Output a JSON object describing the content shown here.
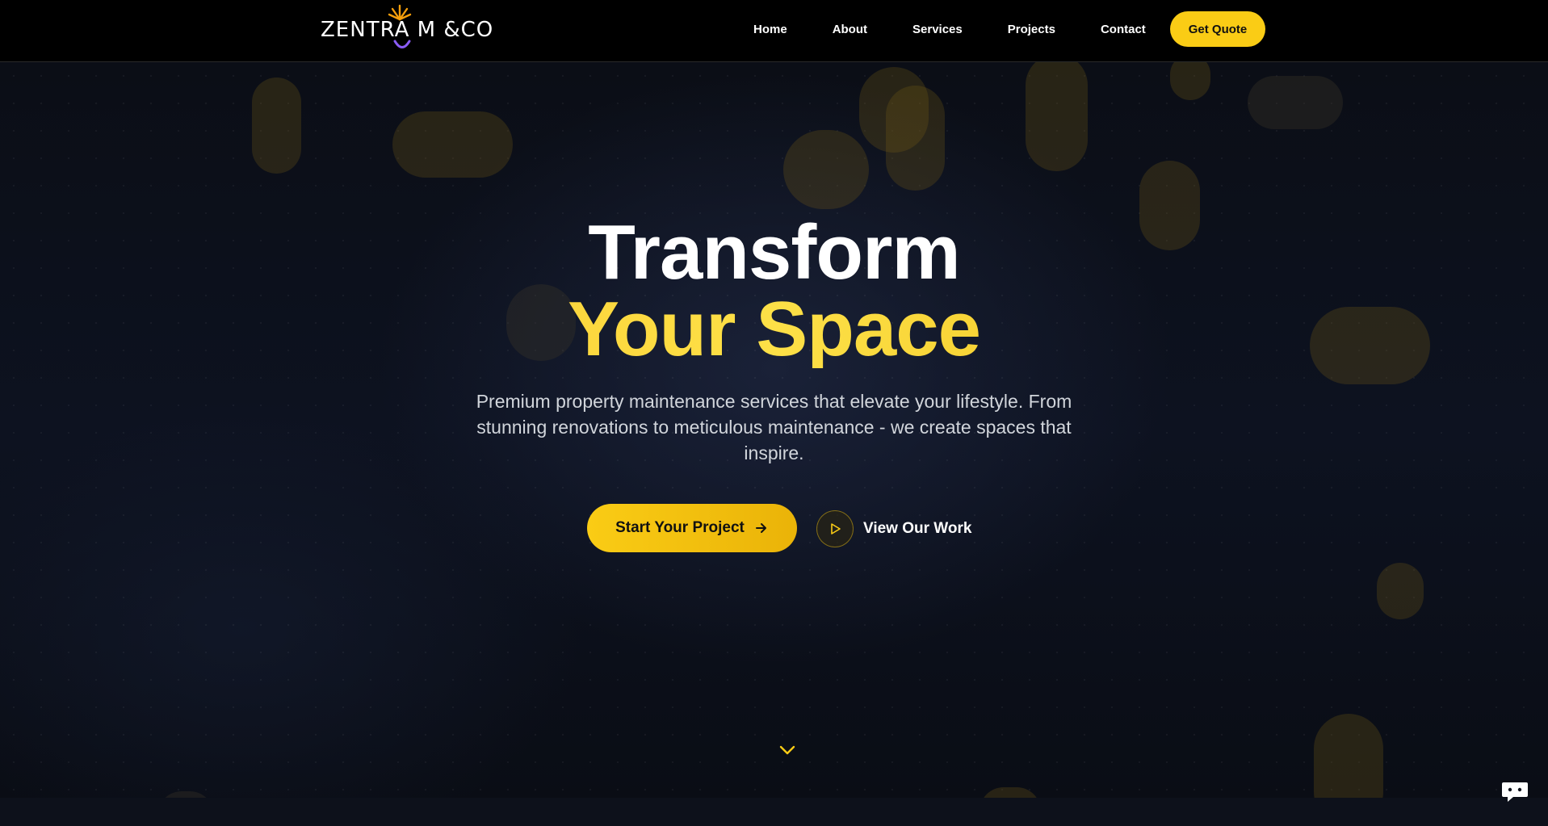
{
  "brand": {
    "logo_text": "ZENTRA M &CO",
    "accent": "#facc15"
  },
  "nav": {
    "items": [
      {
        "label": "Home"
      },
      {
        "label": "About"
      },
      {
        "label": "Services"
      },
      {
        "label": "Projects"
      },
      {
        "label": "Contact"
      }
    ],
    "cta_label": "Get Quote"
  },
  "hero": {
    "headline_line1": "Transform",
    "headline_line2": "Your Space",
    "subtitle": "Premium property maintenance services that elevate your lifestyle. From stunning renovations to meticulous maintenance - we create spaces that inspire.",
    "primary_cta": "Start Your Project",
    "secondary_cta": "View Our Work"
  },
  "icons": {
    "logo_sun": "sun-icon",
    "cta_arrow": "arrow-right-icon",
    "play": "play-icon",
    "scroll": "chevron-down-icon",
    "chat": "chat-icon"
  }
}
